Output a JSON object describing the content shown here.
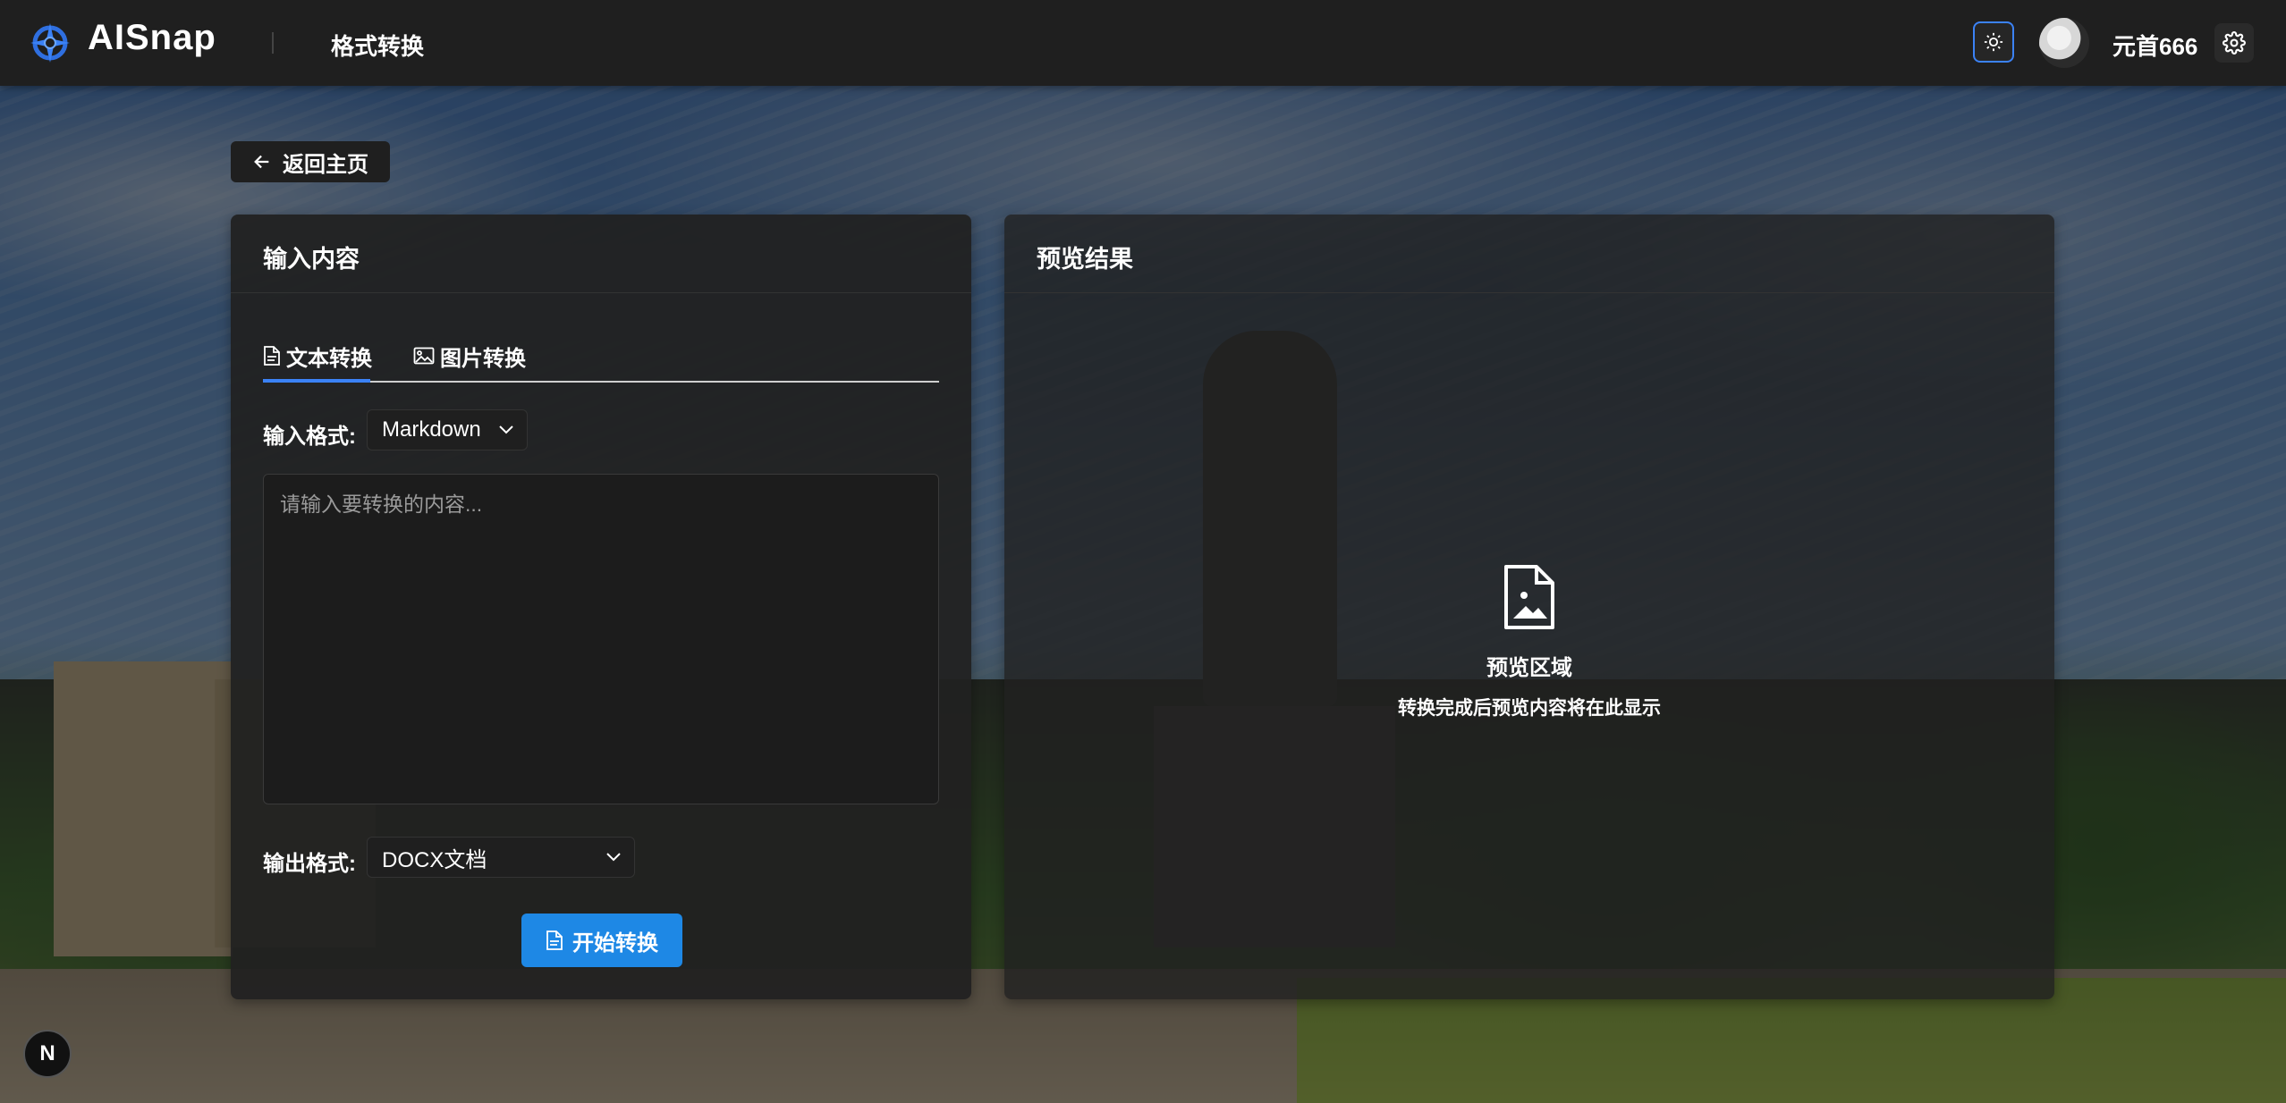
{
  "header": {
    "app_name": "AISnap",
    "page_title": "格式转换",
    "theme_icon": "sun-icon",
    "username": "元首666",
    "settings_icon": "gear-icon"
  },
  "nav": {
    "back_label": "返回主页",
    "back_icon": "arrow-left-icon"
  },
  "input_panel": {
    "title": "输入内容",
    "tabs": [
      {
        "label": "文本转换",
        "icon": "document-icon",
        "active": true
      },
      {
        "label": "图片转换",
        "icon": "image-icon",
        "active": false
      }
    ],
    "input_format_label": "输入格式:",
    "input_format_value": "Markdown",
    "textarea_placeholder": "请输入要转换的内容...",
    "textarea_value": "",
    "output_format_label": "输出格式:",
    "output_format_value": "DOCX文档",
    "convert_button": "开始转换"
  },
  "preview_panel": {
    "title": "预览结果",
    "empty_title": "预览区域",
    "empty_subtitle": "转换完成后预览内容将在此显示"
  },
  "colors": {
    "accent": "#1e88e5",
    "header_bg": "#1f1f1f",
    "panel_bg": "#212121"
  },
  "corner_badge": "N"
}
